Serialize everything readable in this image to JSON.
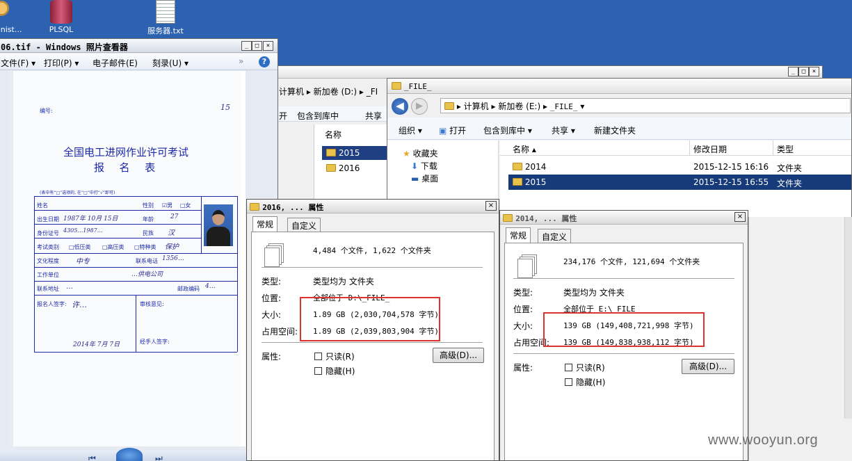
{
  "desktop": {
    "icons": [
      {
        "label": "Administ..."
      },
      {
        "label": "PLSQL"
      },
      {
        "label": "服务器.txt"
      }
    ]
  },
  "photo_viewer": {
    "title": "06.tif - Windows 照片查看器",
    "menu": {
      "file": "文件(F)",
      "print": "打印(P)",
      "email": "电子邮件(E)",
      "burn": "刻录(U)"
    },
    "help": "?",
    "document": {
      "number_label": "编号:",
      "number_value": "15",
      "title_line1": "全国电工进网作业许可考试",
      "title_line2": "报  名  表",
      "instructions": "(表中有“□”选项的, 在“□”中打“√”即可)",
      "fields": {
        "name": "姓名",
        "gender": "性别",
        "male": "☑男",
        "female": "□女",
        "birth": "出生日期",
        "birth_value": "1987年 10月 15日",
        "age": "年龄",
        "age_value": "27",
        "id": "身份证号",
        "id_value": "4305…1987…",
        "ethnic": "民族",
        "ethnic_value": "汉",
        "exam_type": "考试类别",
        "low": "□低压类",
        "high": "□高压类",
        "special": "□特种类",
        "special_value": "保护",
        "education": "文化程度",
        "education_value": "中专",
        "phone": "联系电话",
        "phone_value": "1356…",
        "employer": "工作单位",
        "employer_value": "…供电公司",
        "address": "联系地址",
        "address_value": "…",
        "postcode": "邮政编码",
        "postcode_value": "4…",
        "signature": "报名人签字:",
        "signature_value": "许…",
        "review": "审核意见:",
        "handler": "经手人签字:",
        "date_value": "2014年 7月 7日"
      }
    }
  },
  "explorer_back": {
    "breadcrumb": "计算机 ▸ 新加卷 (D:) ▸ _FI",
    "toolbar": {
      "open": "开",
      "include": "包含到库中",
      "share": "共享"
    },
    "column_name": "名称",
    "items": [
      {
        "name": "2015",
        "selected": true
      },
      {
        "name": "2016",
        "selected": false
      }
    ]
  },
  "explorer_front": {
    "title": "_FILE_",
    "breadcrumb": {
      "computer": "计算机",
      "drive": "新加卷 (E:)",
      "folder": "_FILE_"
    },
    "toolbar": {
      "organize": "组织",
      "open": "打开",
      "include": "包含到库中",
      "share": "共享",
      "new_folder": "新建文件夹"
    },
    "nav": {
      "favorites": "收藏夹",
      "downloads": "下载",
      "desktop": "桌面"
    },
    "columns": {
      "name": "名称",
      "modified": "修改日期",
      "type": "类型"
    },
    "items": [
      {
        "name": "2014",
        "modified": "2015-12-15 16:16",
        "type": "文件夹",
        "selected": false
      },
      {
        "name": "2015",
        "modified": "2015-12-15 16:55",
        "type": "文件夹",
        "selected": true
      }
    ]
  },
  "props_2016": {
    "title": "2016, ... 属性",
    "tabs": {
      "general": "常规",
      "custom": "自定义"
    },
    "summary": "4,484 个文件, 1,622 个文件夹",
    "type_label": "类型:",
    "type_value": "类型均为 文件夹",
    "location_label": "位置:",
    "location_value": "全部位于 D:\\_FILE_",
    "size_label": "大小:",
    "size_value": "1.89 GB (2,030,704,578 字节)",
    "disk_label": "占用空间:",
    "disk_value": "1.89 GB (2,039,803,904 字节)",
    "attr_label": "属性:",
    "readonly": "只读(R)",
    "hidden": "隐藏(H)",
    "advanced": "高级(D)..."
  },
  "props_2014": {
    "title": "2014, ... 属性",
    "tabs": {
      "general": "常规",
      "custom": "自定义"
    },
    "summary": "234,176 个文件, 121,694 个文件夹",
    "type_label": "类型:",
    "type_value": "类型均为 文件夹",
    "location_label": "位置:",
    "location_value": "全部位于 E:\\_FILE_",
    "size_label": "大小:",
    "size_value": "139 GB (149,408,721,998 字节)",
    "disk_label": "占用空间:",
    "disk_value": "139 GB (149,838,938,112 字节)",
    "attr_label": "属性:",
    "readonly": "只读(R)",
    "hidden": "隐藏(H)",
    "advanced": "高级(D)..."
  },
  "watermark": "www.wooyun.org",
  "colors": {
    "desktop": "#2d62b1",
    "highlight": "#e0322d",
    "selection": "#163a7a",
    "ink": "#1c2aa8"
  }
}
